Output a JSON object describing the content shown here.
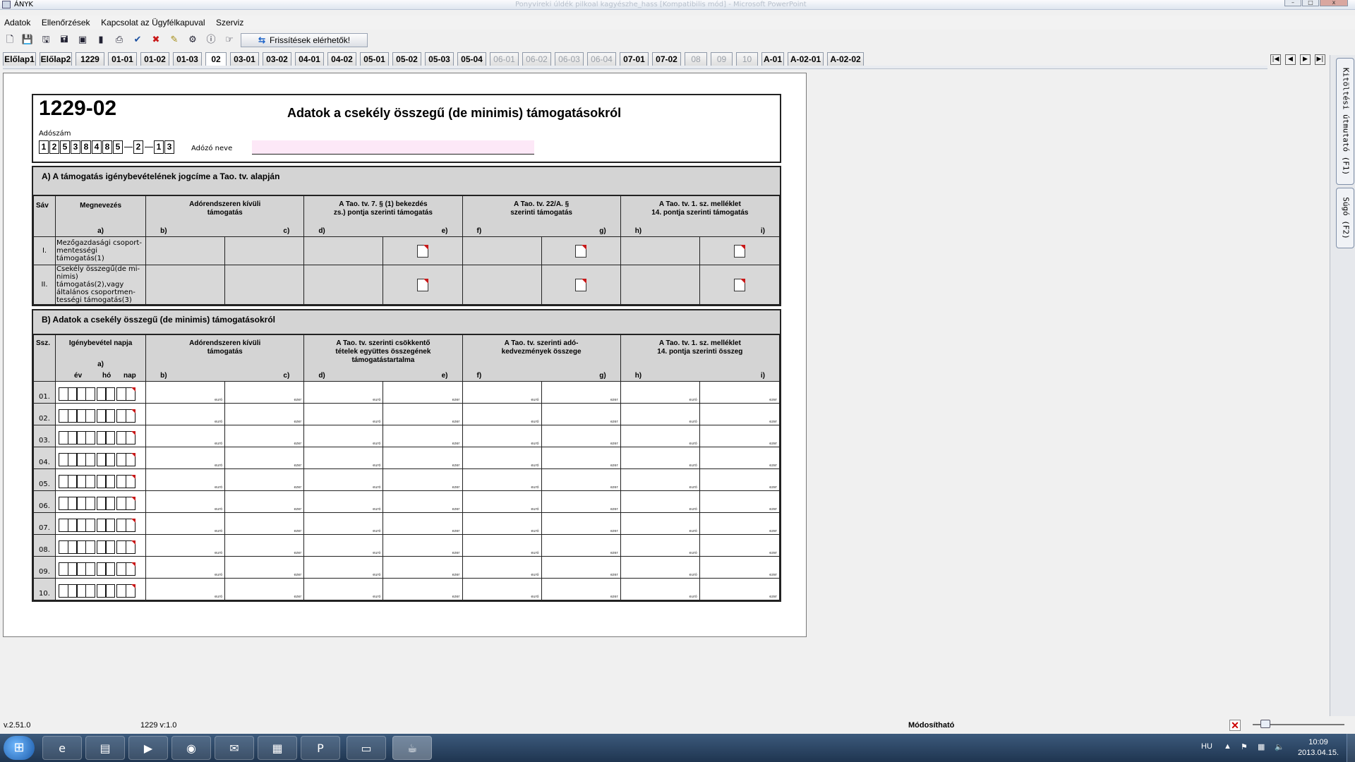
{
  "window": {
    "title": "ÁNYK",
    "background_title": "Ponyvireki úldék pilkoal kagyészhe_hass [Kompatibilis mód] - Microsoft PowerPoint"
  },
  "menu": [
    "Adatok",
    "Ellenőrzések",
    "Kapcsolat az Ügyfélkapuval",
    "Szerviz"
  ],
  "toolbar": {
    "icons": [
      "new-doc-icon",
      "save-icon",
      "save-as-icon",
      "save-all-icon",
      "check-doc-icon",
      "book-icon",
      "print-icon",
      "check-icon",
      "delete-icon",
      "pencil-icon",
      "settings-icon",
      "info-icon",
      "hand-icon"
    ],
    "update_label": "Frissítések elérhetők!"
  },
  "tabs": [
    {
      "label": "Előlap1",
      "state": "normal"
    },
    {
      "label": "Előlap2",
      "state": "normal"
    },
    {
      "label": "1229",
      "state": "normal"
    },
    {
      "label": "01-01",
      "state": "normal"
    },
    {
      "label": "01-02",
      "state": "normal"
    },
    {
      "label": "01-03",
      "state": "normal"
    },
    {
      "label": "02",
      "state": "active"
    },
    {
      "label": "03-01",
      "state": "normal"
    },
    {
      "label": "03-02",
      "state": "normal"
    },
    {
      "label": "04-01",
      "state": "normal"
    },
    {
      "label": "04-02",
      "state": "normal"
    },
    {
      "label": "05-01",
      "state": "normal"
    },
    {
      "label": "05-02",
      "state": "normal"
    },
    {
      "label": "05-03",
      "state": "normal"
    },
    {
      "label": "05-04",
      "state": "normal"
    },
    {
      "label": "06-01",
      "state": "disabled"
    },
    {
      "label": "06-02",
      "state": "disabled"
    },
    {
      "label": "06-03",
      "state": "disabled"
    },
    {
      "label": "06-04",
      "state": "disabled"
    },
    {
      "label": "07-01",
      "state": "normal"
    },
    {
      "label": "07-02",
      "state": "normal"
    },
    {
      "label": "08",
      "state": "disabled"
    },
    {
      "label": "09",
      "state": "disabled"
    },
    {
      "label": "10",
      "state": "disabled"
    },
    {
      "label": "A-01",
      "state": "normal"
    },
    {
      "label": "A-02-01",
      "state": "normal"
    },
    {
      "label": "A-02-02",
      "state": "normal"
    }
  ],
  "nav_buttons": [
    "|◀",
    "◀",
    "▶",
    "▶|"
  ],
  "side_tabs": [
    "Kitöltési útmutató (F1)",
    "Súgó (F2)"
  ],
  "form": {
    "code": "1229-02",
    "title": "Adatok a csekély összegű (de minimis) támogatásokról",
    "taxid_label": "Adószám",
    "taxid_main": [
      "1",
      "2",
      "5",
      "3",
      "8",
      "4",
      "8",
      "5"
    ],
    "taxid_mid": [
      "2"
    ],
    "taxid_end": [
      "1",
      "3"
    ],
    "taxname_label": "Adózó neve"
  },
  "sectionA": {
    "title": "A) A támogatás igénybevételének jogcíme a Tao. tv. alapján",
    "headers": {
      "sav": "Sáv",
      "name": "Megnevezés",
      "name_letter": "a)",
      "col1": "Adórendszeren kívüli\ntámogatás",
      "col2": "A Tao. tv. 7. § (1) bekezdés\nzs.) pontja szerinti támogatás",
      "col3": "A Tao. tv. 22/A. §\nszerinti támogatás",
      "col4": "A Tao. tv. 1. sz. melléklet\n14. pontja szerinti támogatás",
      "letters": [
        "b)",
        "c)",
        "d)",
        "e)",
        "f)",
        "g)",
        "h)",
        "i)"
      ]
    },
    "rows": [
      {
        "sav": "I.",
        "name": "Mezőgazdasági csoport-mentességi támogatás(1)"
      },
      {
        "sav": "II.",
        "name": "Csekély összegű(de mi-nimis) támogatás(2),vagy általános csoportmen-tességi támogatás(3)"
      }
    ]
  },
  "sectionB": {
    "title": "B) Adatok a csekély összegű (de minimis) támogatásokról",
    "headers": {
      "ssz": "Ssz.",
      "date": "Igénybevétel napja",
      "date_letter": "a)",
      "ev": "év",
      "ho": "hó",
      "nap": "nap",
      "col1": "Adórendszeren kívüli\ntámogatás",
      "col2": "A Tao. tv. szerinti csökkentő\ntételek együttes összegének\ntámogatástartalma",
      "col3": "A Tao. tv. szerinti adó-\nkedvezmények összege",
      "col4": "A Tao. tv. 1. sz. melléklet\n14. pontja szerinti összeg",
      "letters": [
        "b)",
        "c)",
        "d)",
        "e)",
        "f)",
        "g)",
        "h)",
        "i)"
      ]
    },
    "unit_euro": "euró",
    "unit_ezer": "ezer",
    "rows": [
      "01.",
      "02.",
      "03.",
      "04.",
      "05.",
      "06.",
      "07.",
      "08.",
      "09.",
      "10."
    ]
  },
  "status": {
    "version": "v.2.51.0",
    "form_version": "1229 v:1.0",
    "mode": "Módosítható"
  },
  "taskbar": {
    "apps": [
      "ie-icon",
      "folder-icon",
      "media-icon",
      "chrome-icon",
      "mail-icon",
      "save-icon",
      "powerpoint-icon",
      "cmd-icon",
      "java-icon"
    ],
    "lang": "HU",
    "time": "10:09",
    "date": "2013.04.15."
  }
}
